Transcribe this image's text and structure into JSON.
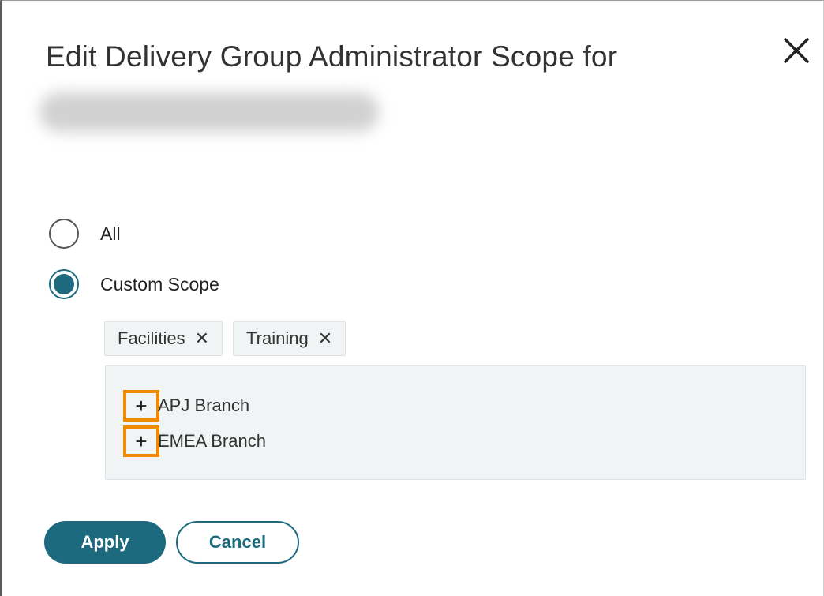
{
  "dialog": {
    "title": "Edit Delivery Group Administrator Scope for",
    "close_icon": "close-icon"
  },
  "scope_options": [
    {
      "label": "All",
      "checked": false
    },
    {
      "label": "Custom Scope",
      "checked": true
    }
  ],
  "selected_scopes": [
    {
      "label": "Facilities",
      "remove_glyph": "✕"
    },
    {
      "label": "Training",
      "remove_glyph": "✕"
    }
  ],
  "tree": {
    "items": [
      {
        "label": "APJ Branch",
        "expander": "+"
      },
      {
        "label": "EMEA Branch",
        "expander": "+"
      }
    ]
  },
  "footer": {
    "apply_label": "Apply",
    "cancel_label": "Cancel"
  },
  "colors": {
    "accent": "#1d6a7e",
    "highlight": "#f08a00",
    "panel_bg": "#f1f4f5"
  }
}
